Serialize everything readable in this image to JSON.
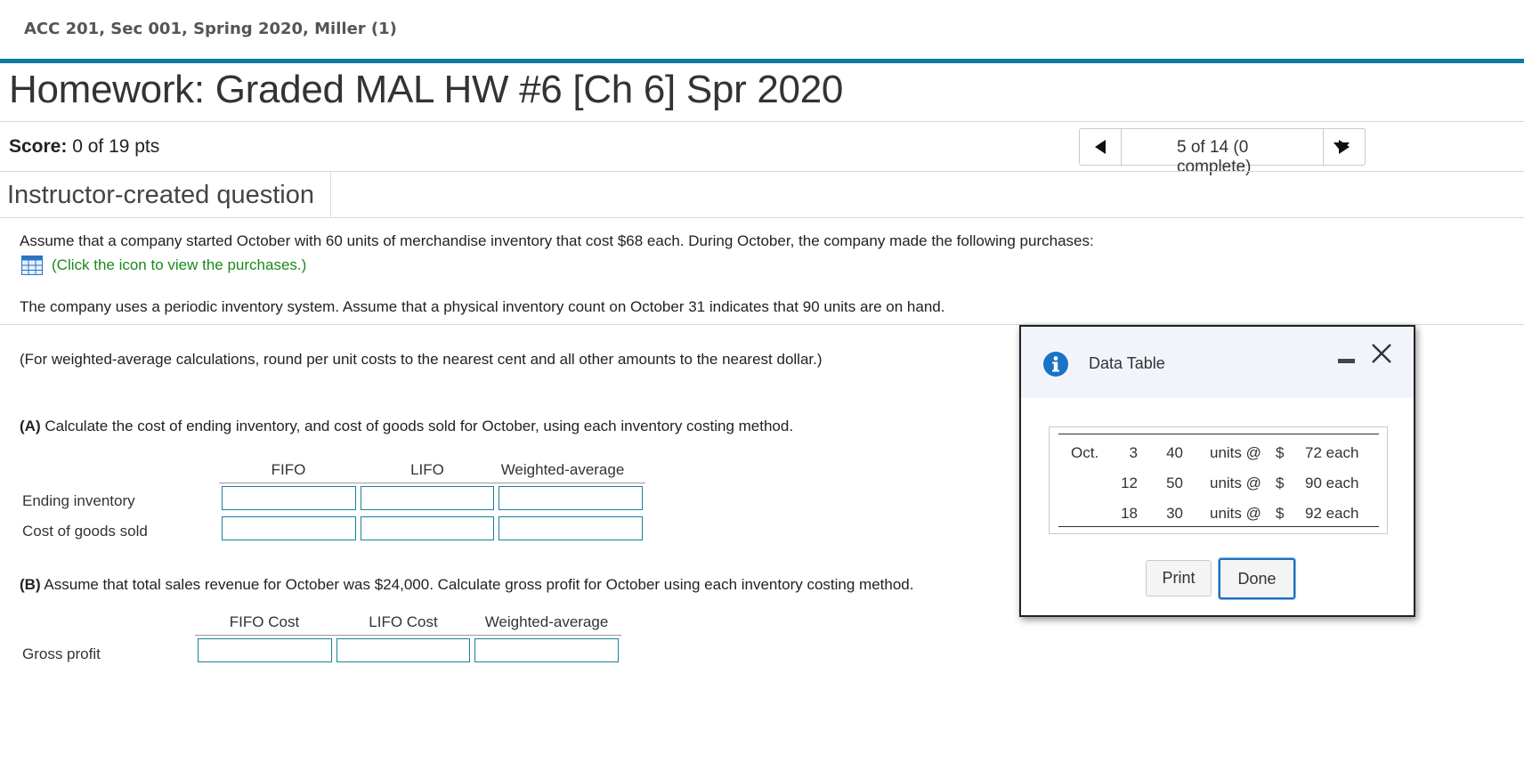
{
  "course": {
    "title": "ACC 201, Sec 001, Spring 2020, Miller (1)"
  },
  "homework": {
    "title": "Homework: Graded MAL HW #6 [Ch 6] Spr 2020"
  },
  "score": {
    "label": "Score:",
    "value": "0 of 19 pts"
  },
  "navigation": {
    "position": "5 of 14 (0 complete)"
  },
  "question": {
    "tab_label": "Instructor-created question",
    "intro": "Assume that a company started October with 60 units of merchandise inventory that cost $68 each. During October, the company made the following purchases:",
    "link_text": "(Click the icon to view the purchases.)",
    "system_text": "The company uses a periodic inventory system.  Assume that a physical inventory count on October 31 indicates that 90 units are on hand.",
    "rounding_note": "(For weighted-average calculations, round per unit costs to the nearest cent and all other amounts to the nearest dollar.)",
    "part_a": {
      "prefix": "(A)",
      "text": " Calculate the cost of ending inventory, and cost of goods sold for October, using each inventory costing method.",
      "columns": [
        "FIFO",
        "LIFO",
        "Weighted-average"
      ],
      "rows": [
        "Ending inventory",
        "Cost of goods sold"
      ]
    },
    "part_b": {
      "prefix": "(B)",
      "text": " Assume that total sales revenue for October was $24,000.  Calculate gross profit for October using each inventory costing method.",
      "columns": [
        "FIFO Cost",
        "LIFO Cost",
        "Weighted-average"
      ],
      "rows": [
        "Gross profit"
      ]
    }
  },
  "data_table": {
    "title": "Data Table",
    "rows": [
      {
        "month": "Oct.",
        "day": "3",
        "units": "40",
        "units_at": "units @",
        "dollar": "$",
        "price": "72 each"
      },
      {
        "month": "",
        "day": "12",
        "units": "50",
        "units_at": "units @",
        "dollar": "$",
        "price": "90 each"
      },
      {
        "month": "",
        "day": "18",
        "units": "30",
        "units_at": "units @",
        "dollar": "$",
        "price": "92 each"
      }
    ],
    "print_label": "Print",
    "done_label": "Done"
  }
}
